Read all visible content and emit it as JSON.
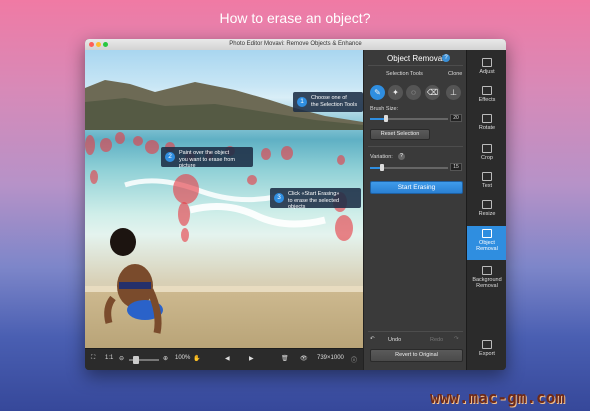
{
  "headline": "How to erase an object?",
  "window": {
    "title": "Photo Editor Movavi: Remove Objects & Enhance"
  },
  "callouts": [
    {
      "num": "1",
      "line1": "Choose one of",
      "line2": "the Selection Tools"
    },
    {
      "num": "2",
      "line1": "Paint over the object",
      "line2": "you want to erase from picture"
    },
    {
      "num": "3",
      "line1": "Click «Start Erasing»",
      "line2": "to erase the selected objects"
    }
  ],
  "bottombar": {
    "ratio": "1:1",
    "zoom": "100%",
    "dimensions": "739×1000"
  },
  "panel": {
    "title": "Object Removal",
    "help": "?",
    "selection_tools": "Selection Tools",
    "clone": "Clone",
    "brush_size_label": "Brush Size:",
    "brush_size": "20",
    "brush_size_fraction": 0.2,
    "reset_selection": "Reset Selection",
    "variation_label": "Variation:",
    "variation": "15",
    "variation_fraction": 0.15,
    "start_erasing": "Start Erasing",
    "undo": "Undo",
    "redo": "Redo",
    "revert": "Revert to Original"
  },
  "sidebar": {
    "items": [
      {
        "label": "Adjust",
        "icon": "sliders-icon"
      },
      {
        "label": "Effects",
        "icon": "magic-wand-icon"
      },
      {
        "label": "Rotate",
        "icon": "rotate-icon"
      },
      {
        "label": "Crop",
        "icon": "crop-icon"
      },
      {
        "label": "Text",
        "icon": "text-icon"
      },
      {
        "label": "Resize",
        "icon": "resize-icon"
      },
      {
        "label": "Object Removal",
        "icon": "eraser-icon",
        "active": true
      },
      {
        "label": "Background Removal",
        "icon": "background-icon"
      },
      {
        "label": "Export",
        "icon": "export-icon"
      }
    ]
  },
  "watermark": "www.mac-gm.com",
  "colors": {
    "accent": "#2f8ee0",
    "selection": "#e63c46",
    "panel": "#3a3a3a"
  }
}
